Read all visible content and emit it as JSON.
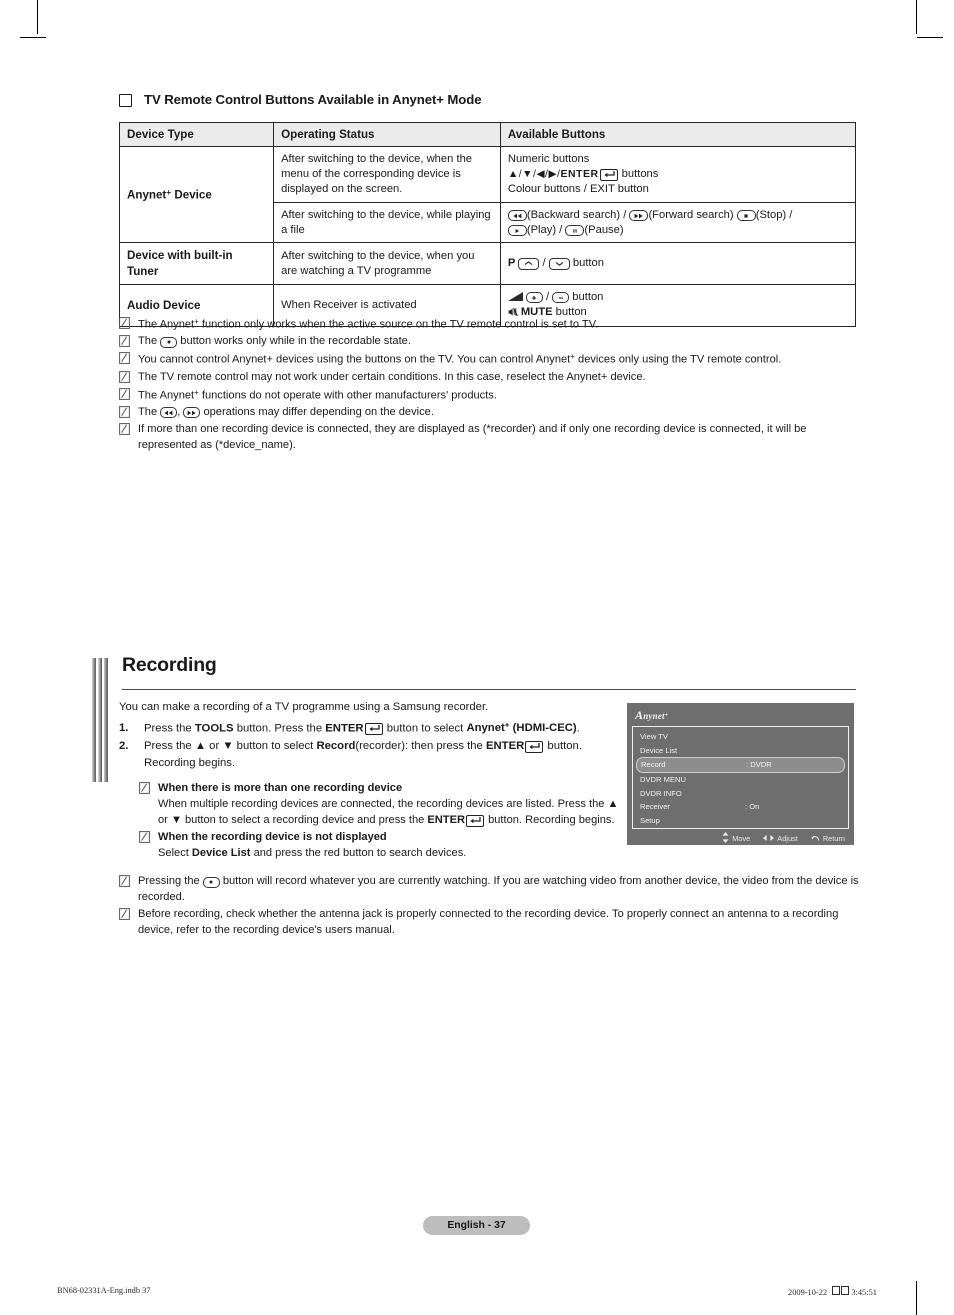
{
  "section": {
    "heading": "TV Remote Control Buttons Available in Anynet+ Mode"
  },
  "table": {
    "headers": [
      "Device Type",
      "Operating Status",
      "Available Buttons"
    ],
    "rows": [
      {
        "device_type": "Anynet+ Device",
        "operating_status": "After switching to the device, when the menu of the corresponding device is displayed on the screen.",
        "available_buttons_lines": [
          "Numeric buttons",
          "▲/▼/◀/▶/ENTER ⏎ buttons",
          "Colour buttons / EXIT button"
        ]
      },
      {
        "device_type": "",
        "operating_status": "After switching to the device, while playing a file",
        "available_buttons_lines": [
          "(Backward search) / (Forward search) (Stop) /",
          "(Play) / (Pause)"
        ]
      },
      {
        "device_type": "Device with built-in Tuner",
        "operating_status": "After switching to the device, when you are watching a TV programme",
        "available_buttons_lines": [
          "P ⌃ / ⌄ button"
        ]
      },
      {
        "device_type": "Audio Device",
        "operating_status": "When Receiver is activated",
        "available_buttons_lines": [
          "+ / − button",
          "MUTE button"
        ]
      }
    ]
  },
  "notes_top": [
    "The Anynet+ function only works when the active source on the TV remote control is set to TV.",
    "The  button works only while in the recordable state.",
    "You cannot control Anynet+ devices using the buttons on the TV. You can control Anynet+ devices only using the TV remote control.",
    "The TV remote control may not work under certain conditions. In this case, reselect the Anynet+ device.",
    "The Anynet+ functions do not operate with other manufacturers' products.",
    "The  ,  operations may differ depending on the device.",
    "If more than one recording device is connected, they are displayed as (*recorder) and if only one recording device is connected, it will be represented as (*device_name)."
  ],
  "recording": {
    "title": "Recording",
    "intro": "You can make a recording of a TV programme using a Samsung recorder.",
    "steps": [
      {
        "num": "1.",
        "text": "Press the TOOLS button. Press the ENTER ⏎ button to select Anynet+ (HDMI-CEC)."
      },
      {
        "num": "2.",
        "text": "Press the ▲ or ▼ button to select Record(recorder): then press the ENTER ⏎ button. Recording begins."
      }
    ],
    "substeps": [
      {
        "title": "When there is more than one recording device",
        "text": "When multiple recording devices are connected, the recording devices are listed. Press the ▲ or ▼ button to select a recording device and press the ENTER ⏎ button. Recording begins."
      },
      {
        "title": "When the recording device is not displayed",
        "text": "Select Device List and press the red button to search devices."
      }
    ]
  },
  "notes_bottom": [
    "Pressing the  button will record whatever you are currently watching. If you are watching video from another device, the video from the device is recorded.",
    "Before recording, check whether the antenna jack is properly connected to the recording device. To properly connect an antenna to a recording device, refer to the recording device's users manual."
  ],
  "osd": {
    "brand": "Anynet",
    "brand_sup": "+",
    "items": [
      {
        "label": "View TV",
        "value": "",
        "selected": false
      },
      {
        "label": "Device List",
        "value": "",
        "selected": false
      },
      {
        "label": "Record",
        "value": ": DVDR",
        "selected": true
      },
      {
        "label": "DVDR MENU",
        "value": "",
        "selected": false
      },
      {
        "label": "DVDR INFO",
        "value": "",
        "selected": false
      },
      {
        "label": "Receiver",
        "value": ": On",
        "selected": false
      },
      {
        "label": "Setup",
        "value": "",
        "selected": false
      }
    ],
    "footer": [
      {
        "icon": "updown-arrow-icon",
        "label": "Move"
      },
      {
        "icon": "leftright-arrow-icon",
        "label": "Adjust"
      },
      {
        "icon": "return-arrow-icon",
        "label": "Return"
      }
    ],
    "colors": {
      "bg": "#6e6e6e",
      "highlight": "#8d8d8d",
      "text": "#f2f2f2"
    }
  },
  "footer": {
    "page_tag": "English - 37",
    "imprint_left": "BN68-02331A-Eng.indb   37",
    "imprint_date": "2009-10-22",
    "imprint_time": "3:45:51"
  }
}
